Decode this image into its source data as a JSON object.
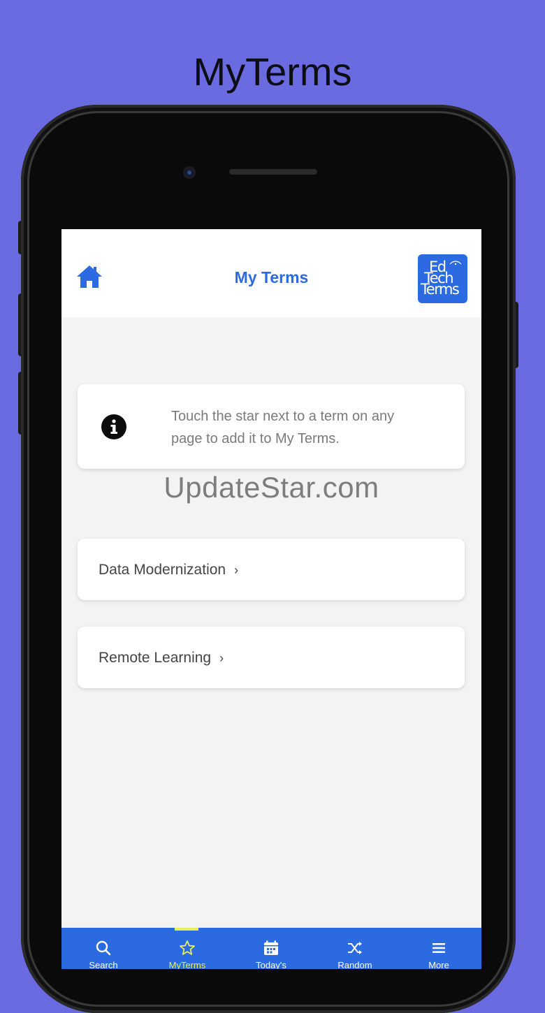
{
  "banner": {
    "title": "MyTerms"
  },
  "header": {
    "title": "My Terms",
    "home_icon": "home-icon"
  },
  "logo": {
    "line1": "Ed",
    "line2": "Tech",
    "line3": "Terms"
  },
  "info": {
    "icon": "info-icon",
    "text": "Touch the star next to a term on any page to add it to My Terms."
  },
  "watermark": "UpdateStar.com",
  "terms": [
    {
      "label": "Data Modernization",
      "chevron": "›"
    },
    {
      "label": "Remote Learning",
      "chevron": "›"
    }
  ],
  "tabs": [
    {
      "label": "Search",
      "icon": "search-icon",
      "active": false
    },
    {
      "label": "MyTerms",
      "icon": "star-icon",
      "active": true
    },
    {
      "label": "Today's",
      "icon": "calendar-icon",
      "active": false
    },
    {
      "label": "Random",
      "icon": "shuffle-icon",
      "active": false
    },
    {
      "label": "More",
      "icon": "menu-icon",
      "active": false
    }
  ],
  "colors": {
    "background": "#6a6be0",
    "accent": "#2b6ae0",
    "active_tab": "#e6ef58"
  }
}
